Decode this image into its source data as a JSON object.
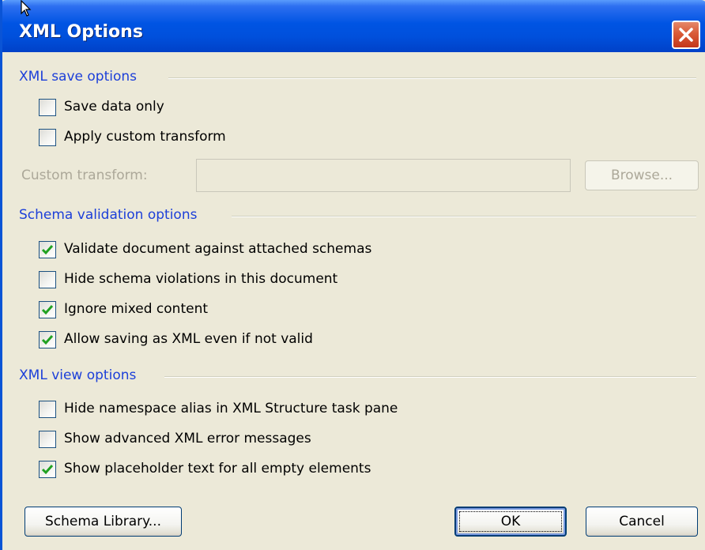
{
  "dialog": {
    "title": "XML Options"
  },
  "save_options": {
    "heading": "XML save options",
    "items": [
      {
        "label": "Save data only",
        "checked": false
      },
      {
        "label": "Apply custom transform",
        "checked": false
      }
    ],
    "custom_transform_label": "Custom transform:",
    "custom_transform_value": "",
    "browse_label": "Browse..."
  },
  "schema_options": {
    "heading": "Schema validation options",
    "items": [
      {
        "label": "Validate document against attached schemas",
        "checked": true
      },
      {
        "label": "Hide schema violations in this document",
        "checked": false
      },
      {
        "label": "Ignore mixed content",
        "checked": true
      },
      {
        "label": "Allow saving as XML even if not valid",
        "checked": true
      }
    ]
  },
  "view_options": {
    "heading": "XML view options",
    "items": [
      {
        "label": "Hide namespace alias in XML Structure task pane",
        "checked": false
      },
      {
        "label": "Show advanced XML error messages",
        "checked": false
      },
      {
        "label": "Show placeholder text for all empty elements",
        "checked": true
      }
    ]
  },
  "buttons": {
    "schema_library": "Schema Library...",
    "ok": "OK",
    "cancel": "Cancel"
  },
  "colors": {
    "title_bar": "#0054e3",
    "section_heading": "#1c3fd9",
    "dialog_background": "#ece9d8",
    "close_button": "#d95a37",
    "checkmark": "#21a121"
  },
  "icons": {
    "close": "close-icon",
    "checkmark": "checkmark-icon",
    "cursor": "mouse-cursor-icon"
  }
}
